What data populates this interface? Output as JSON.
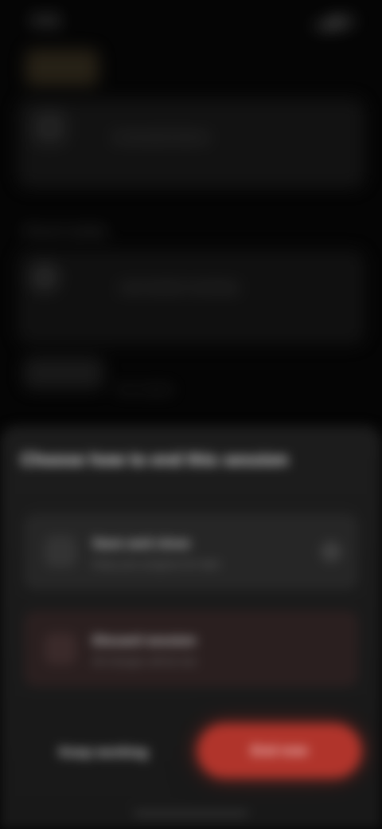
{
  "status_bar": {
    "time": "9:41",
    "icons": "▂▄▆ ▮"
  },
  "background": {
    "card_text": "Connected device",
    "section_label": "Recent activity",
    "row_text": "Last session summary",
    "small_text": "View details"
  },
  "sheet": {
    "title": "Choose how to end this session",
    "options": [
      {
        "label": "Save and close",
        "description": "Keep your progress for later",
        "icon": "save-icon"
      },
      {
        "label": "Discard session",
        "description": "All changes will be lost",
        "icon": "trash-icon"
      }
    ],
    "secondary_button": "Keep working",
    "primary_button": "End now"
  },
  "colors": {
    "accent": "#b0342b",
    "background": "#050505",
    "sheet": "#1c1c1c"
  }
}
